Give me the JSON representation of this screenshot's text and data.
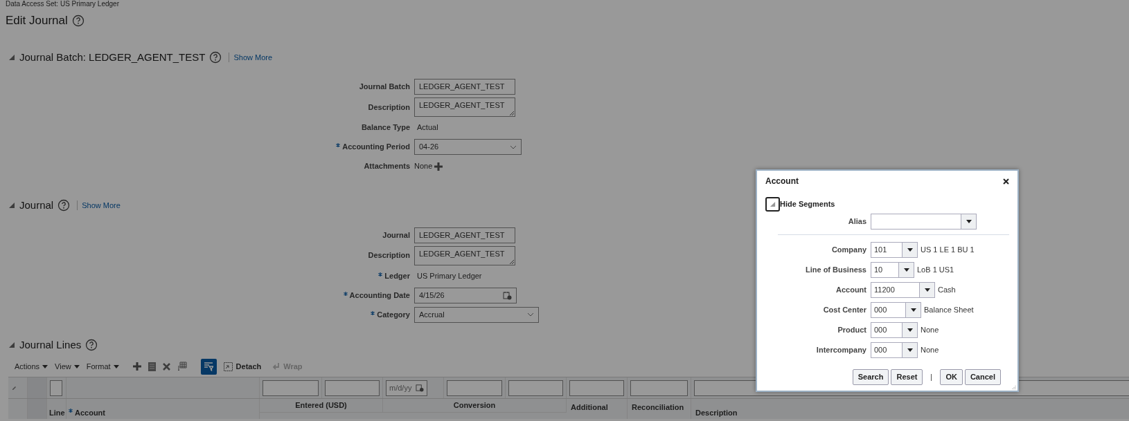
{
  "data_access_set": "Data Access Set: US Primary Ledger",
  "page_title": "Edit Journal",
  "batch_section": {
    "title": "Journal Batch: LEDGER_AGENT_TEST",
    "expanded": true,
    "link": "Show More",
    "fields": [
      {
        "kind": "input",
        "label": "Journal Batch",
        "value": "LEDGER_AGENT_TEST",
        "required": false
      },
      {
        "kind": "textarea",
        "label": "Description",
        "value": "LEDGER_AGENT_TEST",
        "required": false
      },
      {
        "kind": "text",
        "label": "Balance Type",
        "value": "Actual",
        "required": false
      },
      {
        "kind": "select",
        "label": "Accounting Period",
        "value": "04-26",
        "required": true
      },
      {
        "kind": "attachments",
        "label": "Attachments",
        "value": "None",
        "required": false
      }
    ]
  },
  "journal_section": {
    "title": "Journal",
    "expanded": true,
    "link": "Show More",
    "fields": [
      {
        "kind": "input",
        "label": "Journal",
        "value": "LEDGER_AGENT_TEST",
        "required": false
      },
      {
        "kind": "textarea",
        "label": "Description",
        "value": "LEDGER_AGENT_TEST",
        "required": false
      },
      {
        "kind": "text",
        "label": "Ledger",
        "value": "US Primary Ledger",
        "required": true
      },
      {
        "kind": "date",
        "label": "Accounting Date",
        "value": "4/15/26",
        "required": true
      },
      {
        "kind": "selectwide",
        "label": "Category",
        "value": "Accrual",
        "required": true
      }
    ]
  },
  "lines_section": {
    "title": "Journal Lines",
    "expanded": true,
    "toolbar": {
      "menus": [
        "Actions",
        "View",
        "Format"
      ],
      "filter_on": true,
      "detach": "Detach",
      "wrap": {
        "label": "Wrap",
        "disabled": true
      }
    },
    "table": {
      "select_all_checked": false,
      "date_placeholder": "m/d/yy",
      "line_header": "Line",
      "account_header": {
        "label": "Account",
        "required": true
      },
      "groups": [
        "Entered (USD)",
        "Conversion"
      ],
      "other_headers": [
        "Additional",
        "Reconciliation",
        "Description"
      ]
    }
  },
  "dialog": {
    "title": "Account",
    "segments_toggle": {
      "label": "Hide Segments",
      "expanded": true
    },
    "alias_label": "Alias",
    "segments": [
      {
        "label": "Company",
        "value": "101",
        "description": "US 1 LE 1 BU 1"
      },
      {
        "label": "Line of Business",
        "value": "10",
        "description": "LoB 1 US1"
      },
      {
        "label": "Account",
        "value": "11200",
        "description": "Cash"
      },
      {
        "label": "Cost Center",
        "value": "000",
        "description": "Balance Sheet"
      },
      {
        "label": "Product",
        "value": "000",
        "description": "None"
      },
      {
        "label": "Intercompany",
        "value": "000",
        "description": "None"
      }
    ],
    "buttons": [
      "Search",
      "Reset",
      "OK",
      "Cancel"
    ]
  }
}
